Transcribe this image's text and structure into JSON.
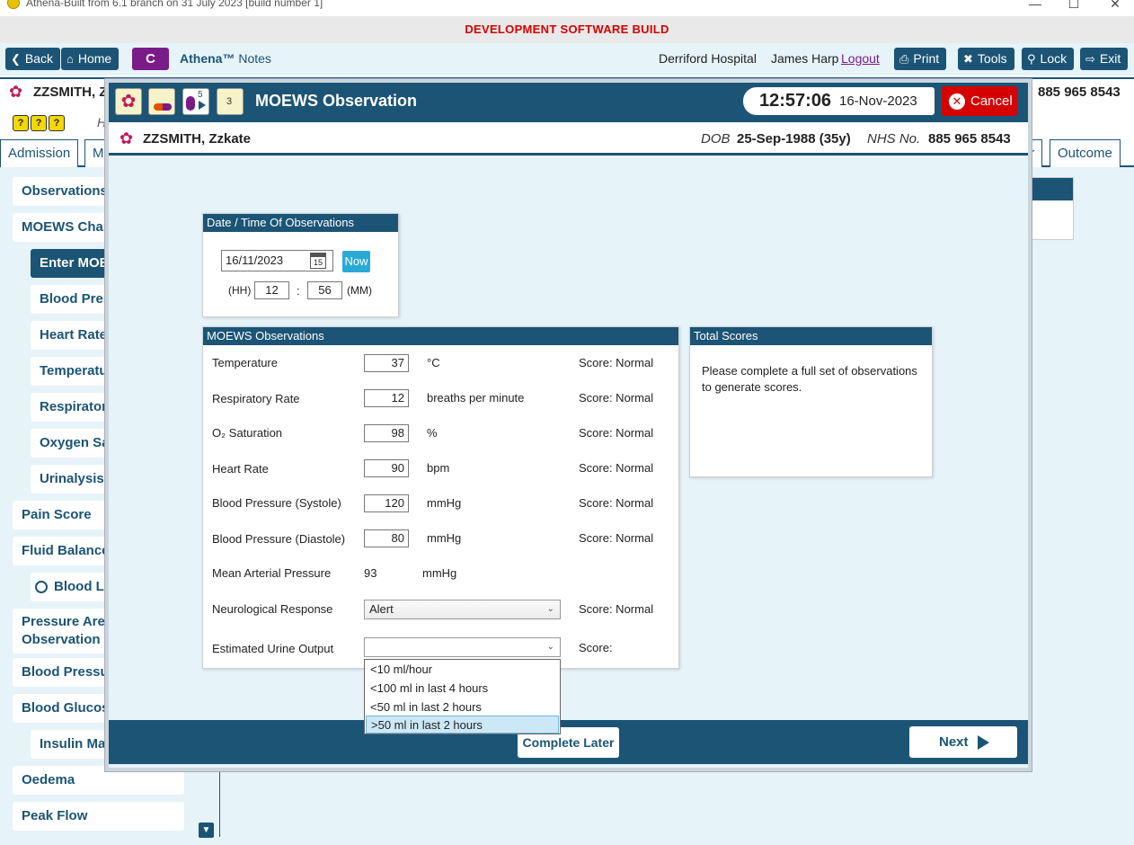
{
  "window": {
    "title": "Athena-Built from 6.1 branch on 31 July 2023 [build number 1]",
    "minimize": "—",
    "maximize": "☐",
    "close": "✕"
  },
  "banner": "DEVELOPMENT SOFTWARE BUILD",
  "toolbar": {
    "back": "Back",
    "home": "Home",
    "c": "C",
    "athena_brand": "Athena™",
    "athena_section": "Notes",
    "hospital": "Derriford Hospital",
    "user": "James Harp",
    "logout": "Logout",
    "print": "Print",
    "tools": "Tools",
    "lock": "Lock",
    "exit": "Exit"
  },
  "background": {
    "patient_name": "ZZSMITH, Z",
    "nhs": "885 965 8543",
    "h_text": "H",
    "tabs": [
      "Admission",
      "M",
      "ur",
      "Outcome"
    ],
    "nav": {
      "observations": "Observations",
      "moews_chart": "MOEWS Chart",
      "enter_moews": "Enter MOEWS",
      "blood_pressure": "Blood Pressure",
      "heart_rate": "Heart Rate",
      "temperature": "Temperature",
      "respiratory": "Respiratory Rate",
      "oxygen_sat": "Oxygen Saturation",
      "urinalysis": "Urinalysis",
      "pain_score": "Pain Score",
      "fluid_balance": "Fluid Balance",
      "blood_loss": "Blood Loss",
      "pressure_areas_1": "Pressure Areas",
      "pressure_areas_2": "Observation",
      "blood_pressure_2": "Blood Pressure",
      "blood_glucose": "Blood Glucose",
      "insulin": "Insulin Management",
      "oedema": "Oedema",
      "peak_flow": "Peak Flow"
    }
  },
  "modal": {
    "icon_counts": {
      "bubbles": "5",
      "calendar": "3"
    },
    "title": "MOEWS Observation",
    "clock_time": "12:57:06",
    "clock_date": "16-Nov-2023",
    "cancel": "Cancel",
    "patient": {
      "name": "ZZSMITH, Zzkate",
      "dob_label": "DOB",
      "dob": "25-Sep-1988 (35y)",
      "nhs_label": "NHS No.",
      "nhs": "885 965 8543"
    },
    "datetime_panel": {
      "header": "Date / Time Of Observations",
      "date": "16/11/2023",
      "calendar_day": "15",
      "now": "Now",
      "hh_label": "(HH)",
      "hh": "12",
      "colon": ":",
      "mm": "56",
      "mm_label": "(MM)"
    },
    "obs_panel": {
      "header": "MOEWS Observations",
      "rows": [
        {
          "label": "Temperature",
          "value": "37",
          "unit": "°C",
          "score": "Score: Normal"
        },
        {
          "label": "Respiratory Rate",
          "value": "12",
          "unit": "breaths per minute",
          "score": "Score: Normal"
        },
        {
          "label": "O₂ Saturation",
          "value": "98",
          "unit": "%",
          "score": "Score: Normal"
        },
        {
          "label": "Heart Rate",
          "value": "90",
          "unit": "bpm",
          "score": "Score: Normal"
        },
        {
          "label": "Blood Pressure (Systole)",
          "value": "120",
          "unit": "mmHg",
          "score": "Score: Normal"
        },
        {
          "label": "Blood Pressure (Diastole)",
          "value": "80",
          "unit": "mmHg",
          "score": "Score: Normal"
        }
      ],
      "map": {
        "label": "Mean Arterial Pressure",
        "value": "93",
        "unit": "mmHg"
      },
      "neuro": {
        "label": "Neurological Response",
        "value": "Alert",
        "score": "Score: Normal"
      },
      "urine": {
        "label": "Estimated Urine Output",
        "value": "",
        "score": "Score:",
        "options": [
          "<10 ml/hour",
          "<100 ml in last 4 hours",
          "<50 ml in last 2 hours",
          ">50 ml in last 2 hours"
        ],
        "highlighted_option": ">50 ml in last 2 hours"
      }
    },
    "scores_panel": {
      "header": "Total Scores",
      "message": "Please complete a full set of observations to generate scores."
    },
    "footer": {
      "complete_later": "Complete Later",
      "next": "Next"
    }
  },
  "colors": {
    "primary": "#1b5475",
    "banner_text": "#d50000",
    "cancel": "#d50000",
    "accent_purple": "#7a1b88",
    "now_button": "#29a9d6",
    "content_bg": "#e6f3f8"
  }
}
